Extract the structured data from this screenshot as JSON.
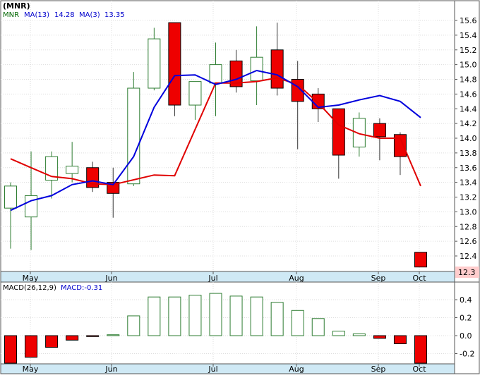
{
  "chart_data": [
    {
      "type": "candlestick",
      "title": "(MNR)",
      "legend": {
        "ticker": "MNR",
        "ma_slow_label": "MA(13)",
        "ma_slow_value": "14.28",
        "ma_fast_label": "MA(3)",
        "ma_fast_value": "13.35"
      },
      "ylim": [
        12.2,
        15.7
      ],
      "y_ticks": [
        "15.6",
        "15.4",
        "15.2",
        "15.0",
        "14.8",
        "14.6",
        "14.4",
        "14.2",
        "14.0",
        "13.8",
        "13.6",
        "13.4",
        "13.2",
        "13.0",
        "12.8",
        "12.6",
        "12.4"
      ],
      "last_price_label": "12.3",
      "x_labels": [
        "May",
        "Jun",
        "Jul",
        "Aug",
        "Sep",
        "Oct"
      ],
      "candles": [
        {
          "o": 13.05,
          "h": 13.4,
          "l": 12.5,
          "c": 13.35
        },
        {
          "o": 12.93,
          "h": 13.82,
          "l": 12.48,
          "c": 13.22
        },
        {
          "o": 13.43,
          "h": 13.82,
          "l": 13.18,
          "c": 13.75
        },
        {
          "o": 13.52,
          "h": 13.95,
          "l": 13.4,
          "c": 13.62
        },
        {
          "o": 13.6,
          "h": 13.68,
          "l": 13.27,
          "c": 13.33
        },
        {
          "o": 13.4,
          "h": 13.6,
          "l": 12.92,
          "c": 13.25
        },
        {
          "o": 13.38,
          "h": 14.9,
          "l": 13.35,
          "c": 14.68
        },
        {
          "o": 14.68,
          "h": 15.5,
          "l": 14.65,
          "c": 15.35
        },
        {
          "o": 15.57,
          "h": 15.57,
          "l": 14.3,
          "c": 14.45
        },
        {
          "o": 14.45,
          "h": 14.77,
          "l": 14.25,
          "c": 14.77
        },
        {
          "o": 14.75,
          "h": 15.3,
          "l": 14.3,
          "c": 15.0
        },
        {
          "o": 15.05,
          "h": 15.2,
          "l": 14.62,
          "c": 14.7
        },
        {
          "o": 14.78,
          "h": 15.52,
          "l": 14.45,
          "c": 15.1
        },
        {
          "o": 15.2,
          "h": 15.57,
          "l": 14.58,
          "c": 14.68
        },
        {
          "o": 14.8,
          "h": 15.05,
          "l": 13.85,
          "c": 14.5
        },
        {
          "o": 14.6,
          "h": 14.68,
          "l": 14.22,
          "c": 14.4
        },
        {
          "o": 14.4,
          "h": 14.4,
          "l": 13.45,
          "c": 13.77
        },
        {
          "o": 13.88,
          "h": 14.35,
          "l": 13.75,
          "c": 14.27
        },
        {
          "o": 14.2,
          "h": 14.27,
          "l": 13.7,
          "c": 14.02
        },
        {
          "o": 14.05,
          "h": 14.08,
          "l": 13.5,
          "c": 13.75
        },
        {
          "o": 12.45,
          "h": 12.45,
          "l": 12.25,
          "c": 12.25
        }
      ],
      "ma3": [
        13.72,
        13.6,
        13.48,
        13.45,
        13.38,
        13.37,
        null,
        13.5,
        13.49,
        null,
        14.75,
        14.75,
        14.77,
        14.82,
        14.73,
        14.48,
        14.18,
        14.06,
        14.0,
        14.0,
        13.35
      ],
      "ma13": [
        13.02,
        13.15,
        13.22,
        13.37,
        13.42,
        13.37,
        13.75,
        14.42,
        14.85,
        14.86,
        14.73,
        14.8,
        14.92,
        14.86,
        14.7,
        14.42,
        14.45,
        14.52,
        14.58,
        14.5,
        14.28
      ],
      "ma3_label_color": "#c00000",
      "ma13_label_color": "#0000cc",
      "up_color": "#2e7d32",
      "down_color": "#ee0000"
    },
    {
      "type": "bar",
      "title": "MACD(26,12,9)",
      "value_label": "MACD:-0.31",
      "ylim": [
        -0.33,
        0.5
      ],
      "y_ticks": [
        "0.4",
        "0.2",
        "0.0",
        "-0.2"
      ],
      "x_labels": [
        "May",
        "Jun",
        "Jul",
        "Aug",
        "Sep",
        "Oct"
      ],
      "values": [
        -0.35,
        -0.24,
        -0.13,
        -0.05,
        -0.01,
        0.01,
        0.22,
        0.43,
        0.43,
        0.45,
        0.47,
        0.44,
        0.43,
        0.37,
        0.28,
        0.19,
        0.05,
        0.02,
        -0.03,
        -0.09,
        -0.31
      ]
    }
  ]
}
